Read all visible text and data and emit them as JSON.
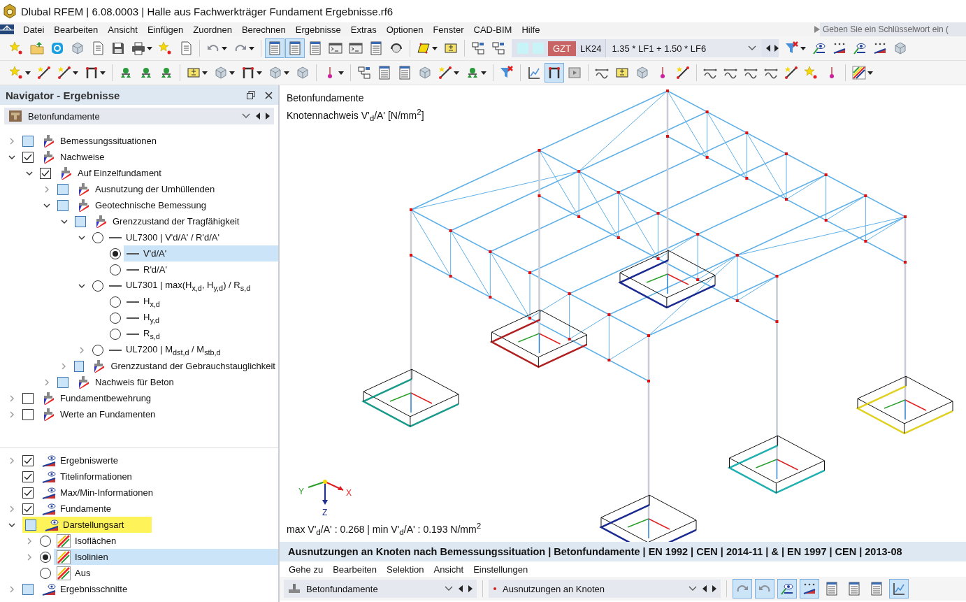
{
  "window": {
    "title": "Dlubal RFEM | 6.08.0003 | Halle aus Fachwerkträger Fundament Ergebnisse.rf6"
  },
  "menu": [
    "Datei",
    "Bearbeiten",
    "Ansicht",
    "Einfügen",
    "Zuordnen",
    "Berechnen",
    "Ergebnisse",
    "Extras",
    "Optionen",
    "Fenster",
    "CAD-BIM",
    "Hilfe"
  ],
  "search": {
    "placeholder": "Geben Sie ein Schlüsselwort ein ("
  },
  "toolbars": [
    {
      "items": [
        {
          "kind": "star",
          "selected": false,
          "dropdown": false
        },
        {
          "kind": "folder",
          "selected": false,
          "dropdown": false
        },
        {
          "kind": "circle",
          "selected": false,
          "dropdown": false
        },
        {
          "kind": "cube",
          "selected": false,
          "dropdown": false
        },
        {
          "kind": "doc",
          "selected": false,
          "dropdown": false
        },
        {
          "kind": "save",
          "selected": false,
          "dropdown": false
        },
        {
          "kind": "print",
          "selected": false,
          "dropdown": true
        },
        {
          "kind": "star",
          "selected": false,
          "dropdown": false
        },
        {
          "kind": "doc",
          "selected": false,
          "dropdown": false
        },
        {
          "kind": "sep"
        },
        {
          "kind": "undo",
          "selected": false,
          "dropdown": true
        },
        {
          "kind": "redo",
          "selected": false,
          "dropdown": true
        },
        {
          "kind": "sep"
        },
        {
          "kind": "table",
          "selected": true,
          "dropdown": false
        },
        {
          "kind": "table",
          "selected": true,
          "dropdown": false
        },
        {
          "kind": "table",
          "selected": false,
          "dropdown": false
        },
        {
          "kind": "terminal",
          "selected": false,
          "dropdown": false
        },
        {
          "kind": "terminal",
          "selected": false,
          "dropdown": false
        },
        {
          "kind": "table",
          "selected": false,
          "dropdown": false
        },
        {
          "kind": "headset",
          "selected": false,
          "dropdown": false
        },
        {
          "kind": "sep"
        },
        {
          "kind": "para",
          "selected": false,
          "dropdown": true
        },
        {
          "kind": "box",
          "selected": false,
          "dropdown": false
        },
        {
          "kind": "sep"
        },
        {
          "kind": "node",
          "selected": false,
          "dropdown": false
        },
        {
          "kind": "node",
          "selected": false,
          "dropdown": false
        },
        {
          "kind": "loadcase"
        },
        {
          "kind": "filter",
          "selected": false,
          "dropdown": true
        },
        {
          "kind": "eye",
          "selected": false,
          "dropdown": false
        },
        {
          "kind": "dots",
          "selected": false,
          "dropdown": false
        },
        {
          "kind": "eye",
          "selected": false,
          "dropdown": false
        },
        {
          "kind": "dots",
          "selected": false,
          "dropdown": false
        },
        {
          "kind": "cube",
          "selected": false,
          "dropdown": false
        }
      ]
    },
    {
      "items": [
        {
          "kind": "star",
          "selected": false,
          "dropdown": true
        },
        {
          "kind": "line",
          "selected": false,
          "dropdown": false
        },
        {
          "kind": "line",
          "selected": false,
          "dropdown": true
        },
        {
          "kind": "frame",
          "selected": false,
          "dropdown": true
        },
        {
          "kind": "sep"
        },
        {
          "kind": "support",
          "selected": false,
          "dropdown": false
        },
        {
          "kind": "support",
          "selected": false,
          "dropdown": false
        },
        {
          "kind": "support",
          "selected": false,
          "dropdown": false
        },
        {
          "kind": "sep"
        },
        {
          "kind": "box",
          "selected": false,
          "dropdown": true
        },
        {
          "kind": "cube",
          "selected": false,
          "dropdown": true
        },
        {
          "kind": "frame",
          "selected": false,
          "dropdown": true
        },
        {
          "kind": "cube",
          "selected": false,
          "dropdown": true
        },
        {
          "kind": "cube",
          "selected": false,
          "dropdown": false
        },
        {
          "kind": "sep"
        },
        {
          "kind": "pin",
          "selected": false,
          "dropdown": true
        },
        {
          "kind": "sep"
        },
        {
          "kind": "node",
          "selected": false,
          "dropdown": false
        },
        {
          "kind": "table",
          "selected": false,
          "dropdown": false
        },
        {
          "kind": "table",
          "selected": false,
          "dropdown": false
        },
        {
          "kind": "cube",
          "selected": false,
          "dropdown": false
        },
        {
          "kind": "line",
          "selected": false,
          "dropdown": true
        },
        {
          "kind": "support",
          "selected": false,
          "dropdown": true
        },
        {
          "kind": "sep"
        },
        {
          "kind": "filter",
          "selected": false,
          "dropdown": false
        },
        {
          "kind": "sep"
        },
        {
          "kind": "chart",
          "selected": false,
          "dropdown": false
        },
        {
          "kind": "frame",
          "selected": true,
          "dropdown": false
        },
        {
          "kind": "film",
          "selected": false,
          "dropdown": false
        },
        {
          "kind": "sep"
        },
        {
          "kind": "wave",
          "selected": false,
          "dropdown": false
        },
        {
          "kind": "box",
          "selected": false,
          "dropdown": false
        },
        {
          "kind": "cube",
          "selected": false,
          "dropdown": false
        },
        {
          "kind": "pin",
          "selected": false,
          "dropdown": false
        },
        {
          "kind": "line",
          "selected": false,
          "dropdown": false
        },
        {
          "kind": "sep"
        },
        {
          "kind": "wave",
          "selected": false,
          "dropdown": false
        },
        {
          "kind": "wave",
          "selected": false,
          "dropdown": false
        },
        {
          "kind": "wave",
          "selected": false,
          "dropdown": false
        },
        {
          "kind": "wave",
          "selected": false,
          "dropdown": false
        },
        {
          "kind": "line",
          "selected": false,
          "dropdown": false
        },
        {
          "kind": "star",
          "selected": false,
          "dropdown": false
        },
        {
          "kind": "pin",
          "selected": false,
          "dropdown": false
        },
        {
          "kind": "sep"
        },
        {
          "kind": "rainbow",
          "selected": false,
          "dropdown": true
        }
      ]
    }
  ],
  "load_case": {
    "type": "GZT",
    "name": "LK24",
    "combination": "1.35 * LF1 + 1.50 * LF6"
  },
  "navigator": {
    "title": "Navigator - Ergebnisse",
    "dropdown": "Betonfundamente",
    "tree": [
      {
        "kind": "checkbox",
        "label": "Bemessungssituationen",
        "checked": false,
        "partial": true,
        "selected": false,
        "expanded": false
      },
      {
        "kind": "checkbox",
        "label": "Nachweise",
        "checked": true,
        "selected": false,
        "expanded": true,
        "children": [
          {
            "kind": "checkbox",
            "label": "Auf Einzelfundament",
            "checked": true,
            "selected": false,
            "expanded": true,
            "children": [
              {
                "kind": "checkbox",
                "label": "Ausnutzung der Umhüllenden",
                "checked": false,
                "partial": true,
                "selected": false,
                "expanded": false
              },
              {
                "kind": "checkbox",
                "label": "Geotechnische Bemessung",
                "checked": false,
                "partial": true,
                "selected": false,
                "expanded": true,
                "children": [
                  {
                    "kind": "checkbox",
                    "label": "Grenzzustand der Tragfähigkeit",
                    "checked": false,
                    "partial": true,
                    "selected": false,
                    "expanded": true,
                    "children": [
                      {
                        "kind": "radio",
                        "label": "UL7300 | V'd/A' / R'd/A'",
                        "selected": false,
                        "expanded": true,
                        "children": [
                          {
                            "kind": "radio",
                            "label": "V'd/A'",
                            "selected": true
                          },
                          {
                            "kind": "radio",
                            "label": "R'd/A'",
                            "selected": false
                          }
                        ]
                      },
                      {
                        "kind": "radio",
                        "label": "UL7301 | max(H$_{x,d}$, H$_{y,d}$) / R$_{s,d}$",
                        "selected": false,
                        "expanded": true,
                        "children": [
                          {
                            "kind": "radio",
                            "label": "H$_{x,d}$",
                            "selected": false
                          },
                          {
                            "kind": "radio",
                            "label": "H$_{y,d}$",
                            "selected": false
                          },
                          {
                            "kind": "radio",
                            "label": "R$_{s,d}$",
                            "selected": false
                          }
                        ]
                      },
                      {
                        "kind": "radio",
                        "label": "UL7200 | M$_{dst,d}$ / M$_{stb,d}$",
                        "selected": false,
                        "expanded": false
                      }
                    ]
                  },
                  {
                    "kind": "checkbox",
                    "label": "Grenzzustand der Gebrauchstauglichkeit",
                    "checked": false,
                    "partial": true,
                    "selected": false,
                    "expanded": false
                  }
                ]
              },
              {
                "kind": "checkbox",
                "label": "Nachweis für Beton",
                "checked": false,
                "partial": true,
                "selected": false,
                "expanded": false
              }
            ]
          }
        ]
      },
      {
        "kind": "checkbox",
        "label": "Fundamentbewehrung",
        "checked": false,
        "partial": false,
        "selected": false,
        "expanded": false
      },
      {
        "kind": "checkbox",
        "label": "Werte an Fundamenten",
        "checked": false,
        "partial": false,
        "selected": false,
        "expanded": false
      }
    ],
    "display_tree": [
      {
        "kind": "checkbox",
        "label": "Ergebniswerte",
        "checked": true,
        "selected": false,
        "expanded": false
      },
      {
        "kind": "checkbox",
        "label": "Titelinformationen",
        "checked": true,
        "selected": false
      },
      {
        "kind": "checkbox",
        "label": "Max/Min-Informationen",
        "checked": true,
        "selected": false
      },
      {
        "kind": "checkbox",
        "label": "Fundamente",
        "checked": true,
        "selected": false,
        "expanded": false
      },
      {
        "kind": "checkbox",
        "label": "Darstellungsart",
        "checked": false,
        "partial": true,
        "selected": false,
        "highlighted": true,
        "expanded": true,
        "children": [
          {
            "kind": "radio",
            "label": "Isoflächen",
            "selected": false,
            "expanded": false
          },
          {
            "kind": "radio",
            "label": "Isolinien",
            "selected": true,
            "expanded": false
          },
          {
            "kind": "radio",
            "label": "Aus",
            "selected": false
          }
        ]
      },
      {
        "kind": "checkbox",
        "label": "Ergebnisschnitte",
        "checked": false,
        "partial": true,
        "selected": false,
        "expanded": false
      }
    ]
  },
  "viewport": {
    "title": "Betonfundamente",
    "subtitle": "Knotennachweis V'$_{d}$/A' [N/mm$^{2}$]",
    "axes": [
      "X",
      "Y",
      "Z"
    ],
    "summary": "max V'$_{d}$/A' : 0.268 | min V'$_{d}$/A' : 0.193 N/mm$^{2}$"
  },
  "table_panel": {
    "title": "Ausnutzungen an Knoten nach Bemessungssituation | Betonfundamente | EN 1992 | CEN | 2014-11 | & | EN 1997 | CEN | 2013-08",
    "menu": [
      "Gehe zu",
      "Bearbeiten",
      "Selektion",
      "Ansicht",
      "Einstellungen"
    ],
    "dropdowns": [
      "Betonfundamente",
      "Ausnutzungen an Knoten"
    ],
    "buttons": [
      {
        "kind": "redo",
        "selected": true
      },
      {
        "kind": "undo",
        "selected": true
      },
      {
        "kind": "eye",
        "selected": true
      },
      {
        "kind": "dots",
        "selected": true
      },
      {
        "kind": "table",
        "selected": false
      },
      {
        "kind": "table",
        "selected": false
      },
      {
        "kind": "table",
        "selected": false
      },
      {
        "kind": "chart",
        "selected": true
      }
    ]
  }
}
